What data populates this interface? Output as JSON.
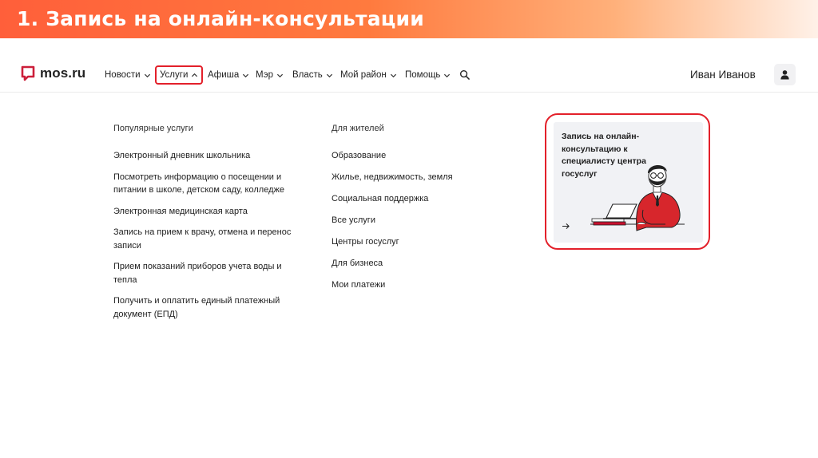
{
  "slide": {
    "title": "1. Запись на онлайн-консультации"
  },
  "header": {
    "logo_text": "mos.ru",
    "nav": [
      {
        "label": "Новости"
      },
      {
        "label": "Услуги"
      },
      {
        "label": "Афиша"
      },
      {
        "label": "Мэр"
      },
      {
        "label": "Власть"
      },
      {
        "label": "Мой район"
      },
      {
        "label": "Помощь"
      }
    ],
    "user_name": "Иван Иванов"
  },
  "menu": {
    "popular": {
      "heading": "Популярные услуги",
      "items": [
        "Электронный дневник школьника",
        "Посмотреть информацию о посещении и питании в школе, детском саду, колледже",
        "Электронная медицинская карта",
        "Запись на прием к врачу, отмена и перенос записи",
        "Прием показаний приборов учета воды и тепла",
        "Получить и оплатить единый платежный документ (ЕПД)"
      ]
    },
    "residents": {
      "heading": "Для жителей",
      "items": [
        "Образование",
        "Жилье, недвижимость, земля",
        "Социальная поддержка",
        "Все услуги",
        "Центры госуслуг",
        "Для бизнеса",
        "Мои платежи"
      ]
    }
  },
  "promo": {
    "title": "Запись на онлайн-консультацию к специалисту центра госуслуг",
    "arrow_icon": "arrow-right-icon"
  },
  "colors": {
    "accent": "#e3202a",
    "title_gradient_start": "#ff5f3a"
  }
}
